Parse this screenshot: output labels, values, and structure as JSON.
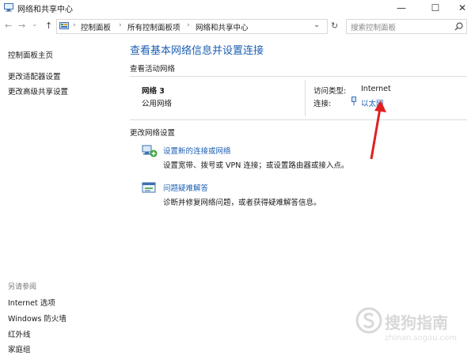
{
  "window": {
    "title": "网络和共享中心",
    "minimize": "—",
    "maximize": "☐",
    "close": "✕"
  },
  "nav": {
    "back": "←",
    "forward": "→",
    "recent": "⌄",
    "up": "↑"
  },
  "breadcrumb": {
    "items": [
      "控制面板",
      "所有控制面板项",
      "网络和共享中心"
    ],
    "separator": "›"
  },
  "address": {
    "dropdown": "⌄",
    "refresh": "↻"
  },
  "search": {
    "placeholder": "搜索控制面板"
  },
  "sidebar": {
    "items": [
      "控制面板主页",
      "更改适配器设置",
      "更改高级共享设置"
    ],
    "see_also_title": "另请参阅",
    "see_also": [
      "Internet 选项",
      "Windows 防火墙",
      "红外线",
      "家庭组"
    ]
  },
  "main": {
    "title": "查看基本网络信息并设置连接",
    "active_networks_label": "查看活动网络",
    "network_name": "网络  3",
    "network_type": "公用网络",
    "access_type_label": "访问类型:",
    "access_type_value": "Internet",
    "connection_label": "连接:",
    "connection_value": "以太网",
    "change_settings_label": "更改网络设置",
    "tasks": [
      {
        "title": "设置新的连接或网络",
        "desc": "设置宽带、拨号或 VPN 连接；或设置路由器或接入点。"
      },
      {
        "title": "问题疑难解答",
        "desc": "诊断并修复网络问题，或者获得疑难解答信息。"
      }
    ]
  },
  "watermark": {
    "text": "搜狗指南",
    "url": "zhinan.sogou.com"
  },
  "colors": {
    "link": "#1b5fb3",
    "annotation_arrow": "#e02020"
  }
}
